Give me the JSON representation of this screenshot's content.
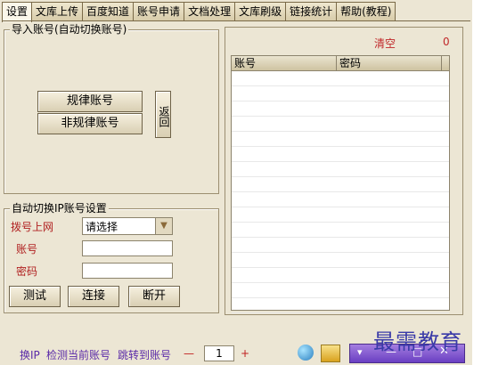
{
  "tabs": [
    "设置",
    "文库上传",
    "百度知道",
    "账号申请",
    "文档处理",
    "文库刷级",
    "链接统计",
    "帮助(教程)"
  ],
  "import_group": {
    "title": "导入账号(自动切换账号)",
    "regular_button": "规律账号",
    "irregular_button": "非规律账号",
    "back_button": "返回"
  },
  "ip_group": {
    "title": "自动切换IP账号设置",
    "dial_label": "拨号上网",
    "dial_select": "请选择",
    "account_label": "账号",
    "password_label": "密码",
    "test_button": "测试",
    "connect_button": "连接",
    "disconnect_button": "断开"
  },
  "right_panel": {
    "clear_label": "清空",
    "count": "0",
    "columns": [
      "账号",
      "密码"
    ]
  },
  "status_bar": {
    "text_change_ip": "换IP",
    "text_detect": "检测当前账号",
    "text_jump": "跳转到账号",
    "minus": "—",
    "page_value": "1",
    "plus": "+"
  },
  "watermark": "最需教育"
}
